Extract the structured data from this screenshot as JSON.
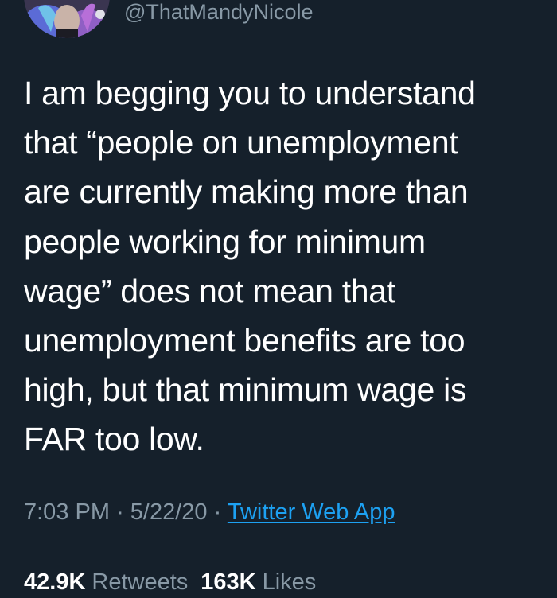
{
  "tweet": {
    "handle": "@ThatMandyNicole",
    "text_lines": [
      "I am begging you to understand",
      "that “people on unemployment",
      "are currently making more than",
      "people working for minimum",
      "wage” does not mean that",
      "unemployment benefits are too",
      "high, but that minimum wage is",
      "FAR too low."
    ],
    "time": "7:03 PM",
    "separator": "·",
    "date": "5/22/20",
    "source": "Twitter Web App",
    "retweets_count": "42.9K",
    "retweets_label": "Retweets",
    "likes_count": "163K",
    "likes_label": "Likes"
  },
  "colors": {
    "background": "#15202b",
    "text": "#ffffff",
    "secondary": "#8899a6",
    "link": "#1da1f2",
    "divider": "#38444d"
  },
  "icons": {
    "avatar": "profile-photo"
  }
}
